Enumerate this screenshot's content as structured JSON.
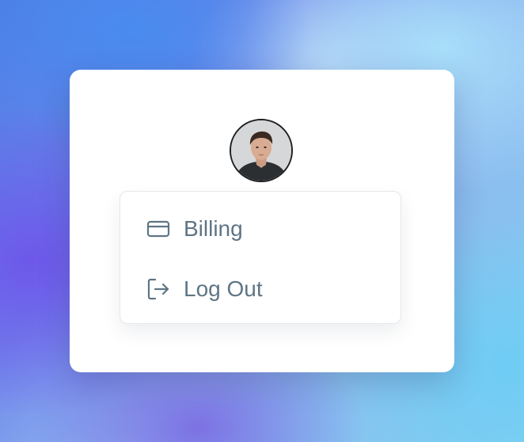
{
  "profile": {
    "avatar_icon": "user-avatar-photo"
  },
  "menu": {
    "items": [
      {
        "label": "Billing",
        "icon": "credit-card-icon"
      },
      {
        "label": "Log Out",
        "icon": "log-out-icon"
      }
    ]
  },
  "colors": {
    "text": "#5f7584",
    "icon": "#5f7584",
    "card": "#ffffff",
    "menu_border": "#e5e7eb"
  }
}
